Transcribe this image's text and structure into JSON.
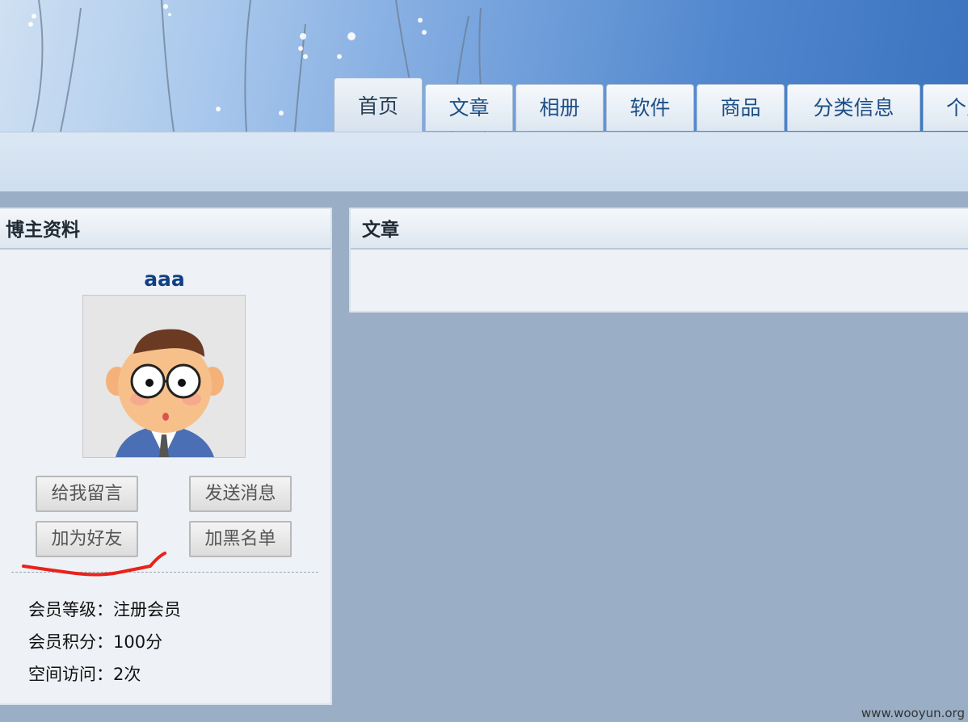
{
  "nav": {
    "tabs": [
      {
        "label": "首页",
        "active": true
      },
      {
        "label": "文章"
      },
      {
        "label": "相册"
      },
      {
        "label": "软件"
      },
      {
        "label": "商品"
      },
      {
        "label": "分类信息"
      },
      {
        "label": "个人"
      }
    ]
  },
  "profile": {
    "title": "博主资料",
    "username": "aaa",
    "buttons": {
      "leave_message": "给我留言",
      "send_message": "发送消息",
      "add_friend": "加为好友",
      "blacklist": "加黑名单"
    },
    "info": {
      "level_label": "会员等级：",
      "level_value": "注册会员",
      "points_label": "会员积分：",
      "points_value": "100分",
      "visits_label": "空间访问：",
      "visits_value": "2次"
    }
  },
  "articles": {
    "title": "文章"
  },
  "watermark": "www.wooyun.org",
  "colors": {
    "accent": "#0f3f85",
    "tab_text": "#1d4f86",
    "page_bg": "#9aafc6",
    "annotation": "#e8221a"
  }
}
